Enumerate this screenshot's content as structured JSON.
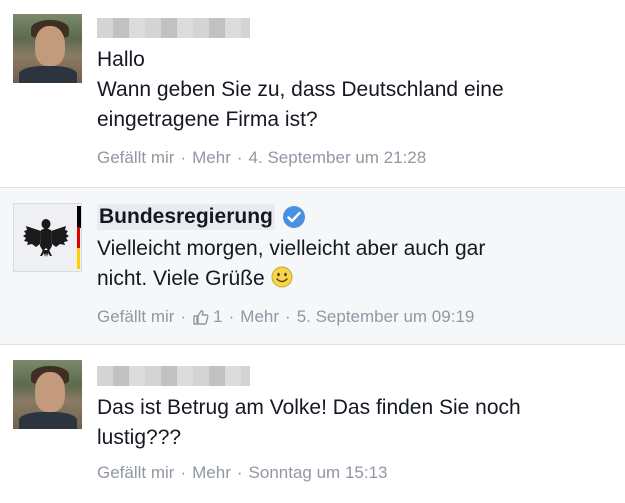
{
  "comments": [
    {
      "author_name": "",
      "author_name_hidden": true,
      "lines": [
        "Hallo",
        "Wann geben Sie zu, dass Deutschland eine",
        "eingetragene Firma ist?"
      ],
      "like_label": "Gefällt mir",
      "more_label": "Mehr",
      "timestamp": "4. September um 21:28"
    },
    {
      "author_name": "Bundesregierung",
      "verified": true,
      "lines": [
        "Vielleicht morgen, vielleicht aber auch gar",
        "nicht. Viele Grüße"
      ],
      "emoji": "smiley-icon",
      "like_label": "Gefällt mir",
      "like_count": "1",
      "more_label": "Mehr",
      "timestamp": "5. September um 09:19"
    },
    {
      "author_name": "",
      "author_name_hidden": true,
      "lines": [
        "Das ist Betrug am Volke! Das finden Sie noch",
        "lustig???"
      ],
      "like_label": "Gefällt mir",
      "more_label": "Mehr",
      "timestamp": "Sonntag um 15:13"
    }
  ],
  "separator": "·",
  "colors": {
    "text": "#141823",
    "meta": "#9197a3",
    "highlight_bg": "#f6f7f9",
    "verified": "#4a90e2"
  }
}
